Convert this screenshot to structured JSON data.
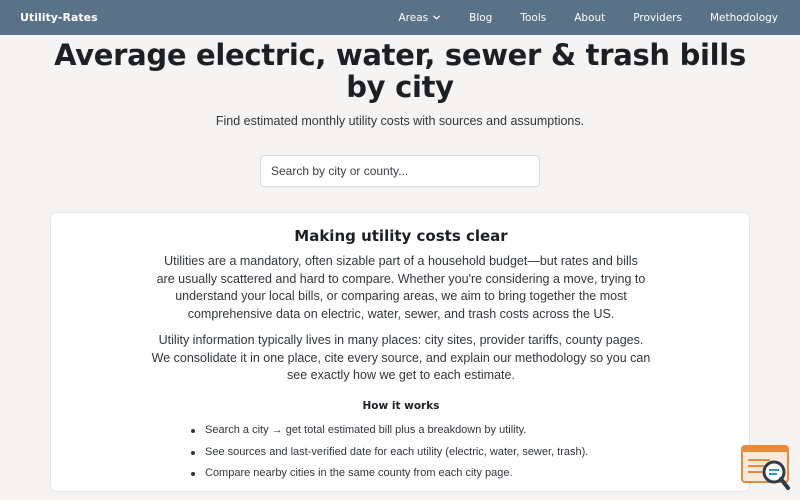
{
  "brand": "Utility-Rates",
  "nav": {
    "areas": "Areas",
    "blog": "Blog",
    "tools": "Tools",
    "about": "About",
    "providers": "Providers",
    "methodology": "Methodology"
  },
  "hero": {
    "title": "Average electric, water, sewer & trash bills by city",
    "subtitle": "Find estimated monthly utility costs with sources and assumptions."
  },
  "search": {
    "placeholder": "Search by city or county..."
  },
  "card": {
    "title": "Making utility costs clear",
    "paragraph1": "Utilities are a mandatory, often sizable part of a household budget—but rates and bills are usually scattered and hard to compare. Whether you're considering a move, trying to understand your local bills, or comparing areas, we aim to bring together the most comprehensive data on electric, water, sewer, and trash costs across the US.",
    "paragraph2": "Utility information typically lives in many places: city sites, provider tariffs, county pages. We consolidate it in one place, cite every source, and explain our methodology so you can see exactly how we get to each estimate.",
    "how_title": "How it works",
    "how_items": [
      "Search a city → get total estimated bill plus a breakdown by utility.",
      "See sources and last-verified date for each utility (electric, water, sewer, trash).",
      "Compare nearby cities in the same county from each city page."
    ]
  },
  "colors": {
    "navbar": "#5a7288",
    "background": "#f5f4f2",
    "widget_accent": "#e8893c",
    "widget_dark": "#2f3b47"
  },
  "icons": {
    "areas_dropdown": "chevron-down-icon",
    "help_widget": "search-chat-icon"
  }
}
